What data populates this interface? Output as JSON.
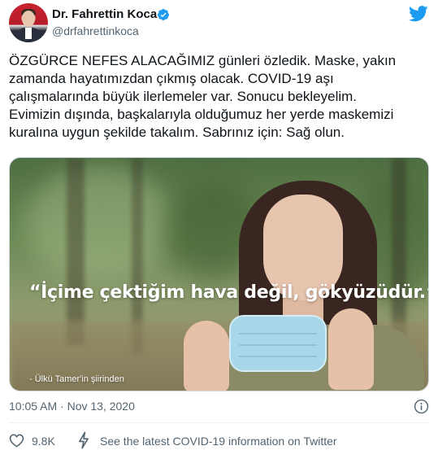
{
  "author": {
    "display_name": "Dr. Fahrettin Koca",
    "handle": "@drfahrettinkoca",
    "verified": true
  },
  "tweet": {
    "text": "ÖZGÜRCE NEFES ALACAĞIMIZ günleri özledik. Maske, yakın\nzamanda hayatımızdan çıkmış olacak. COVID-19 aşı\nçalışmalarında büyük ilerlemeler var. Sonucu bekleyelim.\nEvimizin dışında, başkalarıyla olduğumuz her yerde maskemizi\nkuralına uygun şekilde takalım. Sabrınız için: Sağ olun."
  },
  "media": {
    "quote": "“İçime çektiğim hava değil, gökyüzüdür.”",
    "credit": "- Ülkü Tamer'in şiirinden"
  },
  "footer": {
    "timestamp": "10:05 AM · Nov 13, 2020",
    "like_count": "9.8K",
    "covid_link": "See the latest COVID-19 information on Twitter"
  },
  "icons": {
    "verified": "verified-badge-icon",
    "brand": "twitter-bird-icon",
    "info": "info-icon",
    "like": "heart-icon",
    "covid": "lightning-bolt-icon"
  },
  "colors": {
    "twitter_blue": "#1d9bf0",
    "secondary_text": "#536471",
    "primary_text": "#0f1419"
  }
}
